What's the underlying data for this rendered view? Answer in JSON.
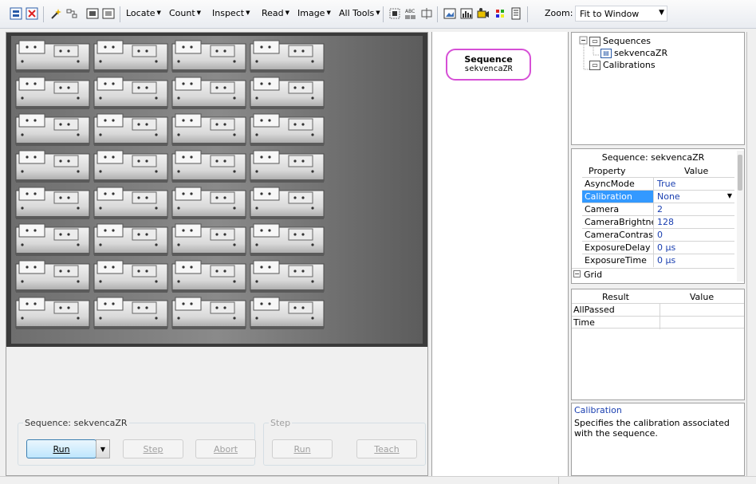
{
  "toolbar": {
    "menus": [
      {
        "label": "Locate"
      },
      {
        "label": "Count"
      },
      {
        "label": "Inspect"
      },
      {
        "label": "Read"
      },
      {
        "label": "Image"
      },
      {
        "label": "All Tools"
      }
    ],
    "zoom_label": "Zoom:",
    "zoom_value": "Fit to Window"
  },
  "sequence_group": {
    "label": "Sequence: sekvencaZR",
    "run": "Run",
    "step": "Step",
    "abort": "Abort"
  },
  "step_group": {
    "label": "Step",
    "run": "Run",
    "teach": "Teach"
  },
  "sequence_node": {
    "title": "Sequence",
    "name": "sekvencaZR"
  },
  "tree": {
    "sequences": "Sequences",
    "sequence_item": "sekvencaZR",
    "calibrations": "Calibrations"
  },
  "properties": {
    "title": "Sequence: sekvencaZR",
    "col_property": "Property",
    "col_value": "Value",
    "rows": [
      {
        "name": "AsyncMode",
        "value": "True"
      },
      {
        "name": "Calibration",
        "value": "None"
      },
      {
        "name": "Camera",
        "value": "2"
      },
      {
        "name": "CameraBrightness",
        "value": "128"
      },
      {
        "name": "CameraContrast",
        "value": "0"
      },
      {
        "name": "ExposureDelay",
        "value": "0 µs"
      },
      {
        "name": "ExposureTime",
        "value": "0 µs"
      }
    ],
    "grid": "Grid"
  },
  "results": {
    "col_result": "Result",
    "col_value": "Value",
    "rows": [
      {
        "name": "AllPassed",
        "value": ""
      },
      {
        "name": "Time",
        "value": ""
      }
    ]
  },
  "help": {
    "title": "Calibration",
    "text": "Specifies the calibration associated with the sequence."
  },
  "colors": {
    "node_border": "#d64fd6",
    "selected": "#3399ff",
    "value_text": "#1a3fb0"
  }
}
